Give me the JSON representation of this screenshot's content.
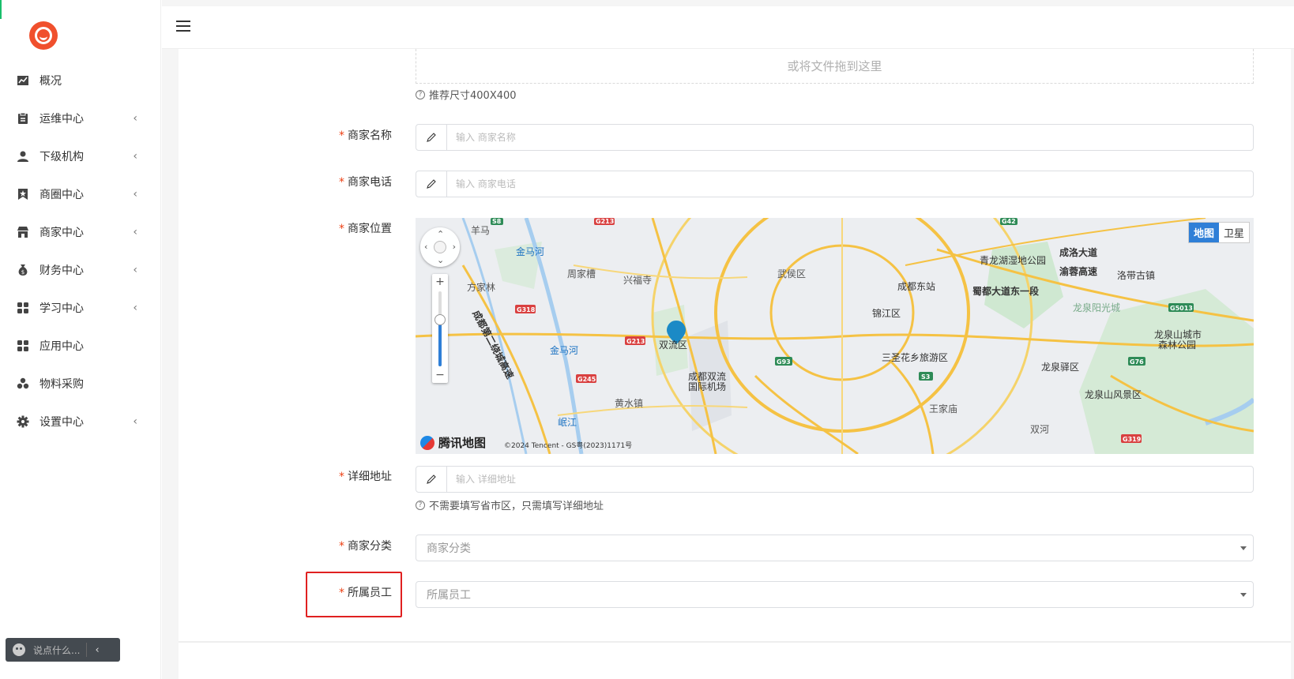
{
  "sidebar": {
    "items": [
      {
        "label": "概况",
        "icon": "chart-icon",
        "has_children": false
      },
      {
        "label": "运维中心",
        "icon": "clipboard-icon",
        "has_children": true
      },
      {
        "label": "下级机构",
        "icon": "user-icon",
        "has_children": true
      },
      {
        "label": "商圈中心",
        "icon": "bookmark-star-icon",
        "has_children": true
      },
      {
        "label": "商家中心",
        "icon": "store-icon",
        "has_children": true
      },
      {
        "label": "财务中心",
        "icon": "money-bag-icon",
        "has_children": true
      },
      {
        "label": "学习中心",
        "icon": "grid-icon",
        "has_children": true
      },
      {
        "label": "应用中心",
        "icon": "apps-grid-icon",
        "has_children": false
      },
      {
        "label": "物料采购",
        "icon": "cubes-icon",
        "has_children": false
      },
      {
        "label": "设置中心",
        "icon": "gear-icon",
        "has_children": true
      }
    ],
    "arrow_glyph": "‹"
  },
  "chat": {
    "placeholder": "说点什么...",
    "arrow": "‹"
  },
  "form": {
    "upload_text": "或将文件拖到这里",
    "upload_hint": "推荐尺寸400X400",
    "name": {
      "label": "商家名称",
      "placeholder": "输入 商家名称",
      "value": ""
    },
    "phone": {
      "label": "商家电话",
      "placeholder": "输入 商家电话",
      "value": ""
    },
    "location": {
      "label": "商家位置"
    },
    "address": {
      "label": "详细地址",
      "placeholder": "输入 详细地址",
      "value": "",
      "hint": "不需要填写省市区，只需填写详细地址"
    },
    "category": {
      "label": "商家分类",
      "placeholder": "商家分类"
    },
    "staff": {
      "label": "所属员工",
      "placeholder": "所属员工"
    },
    "required_mark": "*"
  },
  "map": {
    "toggle": {
      "map": "地图",
      "satellite": "卫星",
      "active": "map"
    },
    "brand": "腾讯地图",
    "copyright": "©2024 Tencent - GS粤(2023)1171号",
    "zoom_level_fraction": 0.62,
    "places": [
      {
        "name": "羊马"
      },
      {
        "name": "金马河"
      },
      {
        "name": "周家槽"
      },
      {
        "name": "兴福寺"
      },
      {
        "name": "方家林"
      },
      {
        "name": "武侯区"
      },
      {
        "name": "成都东站"
      },
      {
        "name": "青龙湖湿地公园"
      },
      {
        "name": "成洛大道"
      },
      {
        "name": "渝蓉高速"
      },
      {
        "name": "洛带古镇"
      },
      {
        "name": "蜀都大道东一段"
      },
      {
        "name": "龙泉阳光城"
      },
      {
        "name": "锦江区"
      },
      {
        "name": "双流区"
      },
      {
        "name": "金马河"
      },
      {
        "name": "成都双流国际机场"
      },
      {
        "name": "三圣花乡旅游区"
      },
      {
        "name": "龙泉驿区"
      },
      {
        "name": "龙泉山城市森林公园"
      },
      {
        "name": "龙泉山风景区"
      },
      {
        "name": "王家庙"
      },
      {
        "name": "黄水镇"
      },
      {
        "name": "岷江"
      },
      {
        "name": "双河"
      },
      {
        "name": "成都第二绕城高速"
      }
    ],
    "road_badges": [
      "G213",
      "G318",
      "G213",
      "G245",
      "G93",
      "S3",
      "G5013",
      "G76",
      "G319",
      "S8",
      "G42"
    ],
    "accent_color": "#2f7fd7"
  },
  "colors": {
    "required": "#ed4014",
    "highlight_border": "#e02020",
    "logo": "#f0502d"
  }
}
